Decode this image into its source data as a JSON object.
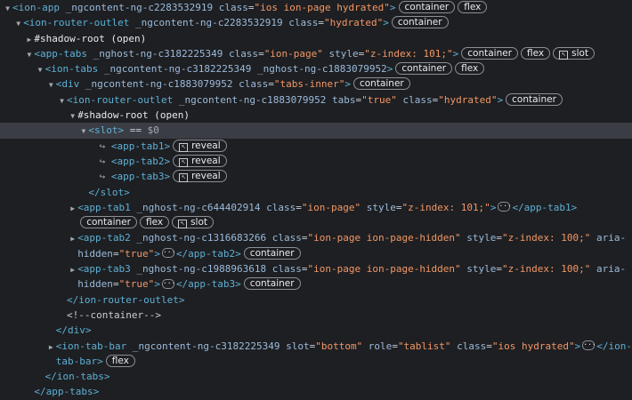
{
  "rows": [
    {
      "indent": 0,
      "tw": "▼",
      "parts": [
        {
          "c": "tag",
          "t": "<ion-app "
        },
        {
          "c": "attr",
          "t": "_ngcontent-ng-c2283532919 class"
        },
        {
          "c": "eq",
          "t": "="
        },
        {
          "c": "val",
          "t": "\"ios ion-page hydrated\""
        },
        {
          "c": "tag",
          "t": ">"
        }
      ],
      "badges": [
        {
          "t": "container"
        },
        {
          "t": "flex"
        }
      ]
    },
    {
      "indent": 1,
      "tw": "▼",
      "parts": [
        {
          "c": "tag",
          "t": "<ion-router-outlet "
        },
        {
          "c": "attr",
          "t": "_ngcontent-ng-c2283532919 class"
        },
        {
          "c": "eq",
          "t": "="
        },
        {
          "c": "val",
          "t": "\"hydrated\""
        },
        {
          "c": "tag",
          "t": ">"
        }
      ],
      "badges": [
        {
          "t": "container"
        }
      ]
    },
    {
      "indent": 2,
      "tw": "▶",
      "parts": [
        {
          "c": "plain",
          "t": "#shadow-root (open)"
        }
      ]
    },
    {
      "indent": 2,
      "tw": "▼",
      "parts": [
        {
          "c": "tag",
          "t": "<app-tabs "
        },
        {
          "c": "attr",
          "t": "_nghost-ng-c3182225349 class"
        },
        {
          "c": "eq",
          "t": "="
        },
        {
          "c": "val",
          "t": "\"ion-page\""
        },
        {
          "c": "attr",
          "t": " style"
        },
        {
          "c": "eq",
          "t": "="
        },
        {
          "c": "val",
          "t": "\"z-index: 101;\""
        },
        {
          "c": "tag",
          "t": ">"
        }
      ],
      "badges": [
        {
          "t": "container"
        },
        {
          "t": "flex"
        },
        {
          "t": "slot",
          "icon": true
        }
      ]
    },
    {
      "indent": 3,
      "tw": "▼",
      "parts": [
        {
          "c": "tag",
          "t": "<ion-tabs "
        },
        {
          "c": "attr",
          "t": "_ngcontent-ng-c3182225349 _nghost-ng-c1883079952"
        },
        {
          "c": "tag",
          "t": ">"
        }
      ],
      "badges": [
        {
          "t": "container"
        },
        {
          "t": "flex"
        }
      ]
    },
    {
      "indent": 4,
      "tw": "▼",
      "parts": [
        {
          "c": "tag",
          "t": "<div "
        },
        {
          "c": "attr",
          "t": "_ngcontent-ng-c1883079952 class"
        },
        {
          "c": "eq",
          "t": "="
        },
        {
          "c": "val",
          "t": "\"tabs-inner\""
        },
        {
          "c": "tag",
          "t": ">"
        }
      ],
      "badges": [
        {
          "t": "container"
        }
      ]
    },
    {
      "indent": 5,
      "tw": "▼",
      "parts": [
        {
          "c": "tag",
          "t": "<ion-router-outlet "
        },
        {
          "c": "attr",
          "t": "_ngcontent-ng-c1883079952 tabs"
        },
        {
          "c": "eq",
          "t": "="
        },
        {
          "c": "val",
          "t": "\"true\""
        },
        {
          "c": "attr",
          "t": " class"
        },
        {
          "c": "eq",
          "t": "="
        },
        {
          "c": "val",
          "t": "\"hydrated\""
        },
        {
          "c": "tag",
          "t": ">"
        }
      ],
      "badges": [
        {
          "t": "container"
        }
      ]
    },
    {
      "indent": 6,
      "tw": "▼",
      "parts": [
        {
          "c": "plain",
          "t": "#shadow-root (open)"
        }
      ]
    },
    {
      "indent": 7,
      "tw": "▼",
      "sel": true,
      "parts": [
        {
          "c": "tag",
          "t": "<slot>"
        },
        {
          "c": "cmt",
          "t": " == "
        },
        {
          "c": "slotref",
          "t": "$0"
        }
      ]
    },
    {
      "indent": 8,
      "tw": "",
      "parts": [
        {
          "c": "arrow",
          "t": "↪ "
        },
        {
          "c": "tag",
          "t": "<app-tab1>"
        }
      ],
      "badges": [
        {
          "t": "reveal",
          "icon": true
        }
      ]
    },
    {
      "indent": 8,
      "tw": "",
      "parts": [
        {
          "c": "arrow",
          "t": "↪ "
        },
        {
          "c": "tag",
          "t": "<app-tab2>"
        }
      ],
      "badges": [
        {
          "t": "reveal",
          "icon": true
        }
      ]
    },
    {
      "indent": 8,
      "tw": "",
      "parts": [
        {
          "c": "arrow",
          "t": "↪ "
        },
        {
          "c": "tag",
          "t": "<app-tab3>"
        }
      ],
      "badges": [
        {
          "t": "reveal",
          "icon": true
        }
      ]
    },
    {
      "indent": 7,
      "tw": "",
      "parts": [
        {
          "c": "tag",
          "t": "</slot>"
        }
      ]
    },
    {
      "indent": 6,
      "tw": "▶",
      "parts": [
        {
          "c": "tag",
          "t": "<app-tab1 "
        },
        {
          "c": "attr",
          "t": "_nghost-ng-c644402914 class"
        },
        {
          "c": "eq",
          "t": "="
        },
        {
          "c": "val",
          "t": "\"ion-page\""
        },
        {
          "c": "attr",
          "t": " style"
        },
        {
          "c": "eq",
          "t": "="
        },
        {
          "c": "val",
          "t": "\"z-index: 101;\""
        },
        {
          "c": "tag",
          "t": ">"
        },
        {
          "c": "ell",
          "t": "···"
        },
        {
          "c": "tag",
          "t": "</app-tab1>"
        }
      ]
    },
    {
      "indent": 6,
      "tw": "",
      "parts": [],
      "badges": [
        {
          "t": "container"
        },
        {
          "t": "flex"
        },
        {
          "t": "slot",
          "icon": true
        }
      ]
    },
    {
      "indent": 6,
      "tw": "▶",
      "parts": [
        {
          "c": "tag",
          "t": "<app-tab2 "
        },
        {
          "c": "attr",
          "t": "_nghost-ng-c1316683266 class"
        },
        {
          "c": "eq",
          "t": "="
        },
        {
          "c": "val",
          "t": "\"ion-page ion-page-hidden\""
        },
        {
          "c": "attr",
          "t": " style"
        },
        {
          "c": "eq",
          "t": "="
        },
        {
          "c": "val",
          "t": "\"z-index: 100;\""
        },
        {
          "c": "attr",
          "t": " aria-"
        }
      ]
    },
    {
      "indent": 6,
      "tw": "",
      "parts": [
        {
          "c": "attr",
          "t": "hidden"
        },
        {
          "c": "eq",
          "t": "="
        },
        {
          "c": "val",
          "t": "\"true\""
        },
        {
          "c": "tag",
          "t": ">"
        },
        {
          "c": "ell",
          "t": "···"
        },
        {
          "c": "tag",
          "t": "</app-tab2>"
        }
      ],
      "badges": [
        {
          "t": "container"
        }
      ]
    },
    {
      "indent": 6,
      "tw": "▶",
      "parts": [
        {
          "c": "tag",
          "t": "<app-tab3 "
        },
        {
          "c": "attr",
          "t": "_nghost-ng-c1988963618 class"
        },
        {
          "c": "eq",
          "t": "="
        },
        {
          "c": "val",
          "t": "\"ion-page ion-page-hidden\""
        },
        {
          "c": "attr",
          "t": " style"
        },
        {
          "c": "eq",
          "t": "="
        },
        {
          "c": "val",
          "t": "\"z-index: 100;\""
        },
        {
          "c": "attr",
          "t": " aria-"
        }
      ]
    },
    {
      "indent": 6,
      "tw": "",
      "parts": [
        {
          "c": "attr",
          "t": "hidden"
        },
        {
          "c": "eq",
          "t": "="
        },
        {
          "c": "val",
          "t": "\"true\""
        },
        {
          "c": "tag",
          "t": ">"
        },
        {
          "c": "ell",
          "t": "···"
        },
        {
          "c": "tag",
          "t": "</app-tab3>"
        }
      ],
      "badges": [
        {
          "t": "container"
        }
      ]
    },
    {
      "indent": 5,
      "tw": "",
      "parts": [
        {
          "c": "tag",
          "t": "</ion-router-outlet>"
        }
      ]
    },
    {
      "indent": 5,
      "tw": "",
      "parts": [
        {
          "c": "cmt",
          "t": "<!--container-->"
        }
      ]
    },
    {
      "indent": 4,
      "tw": "",
      "parts": [
        {
          "c": "tag",
          "t": "</div>"
        }
      ]
    },
    {
      "indent": 4,
      "tw": "▶",
      "parts": [
        {
          "c": "tag",
          "t": "<ion-tab-bar "
        },
        {
          "c": "attr",
          "t": "_ngcontent-ng-c3182225349 slot"
        },
        {
          "c": "eq",
          "t": "="
        },
        {
          "c": "val",
          "t": "\"bottom\""
        },
        {
          "c": "attr",
          "t": " role"
        },
        {
          "c": "eq",
          "t": "="
        },
        {
          "c": "val",
          "t": "\"tablist\""
        },
        {
          "c": "attr",
          "t": " class"
        },
        {
          "c": "eq",
          "t": "="
        },
        {
          "c": "val",
          "t": "\"ios hydrated\""
        },
        {
          "c": "tag",
          "t": ">"
        },
        {
          "c": "ell",
          "t": "···"
        },
        {
          "c": "tag",
          "t": "</ion-"
        }
      ]
    },
    {
      "indent": 4,
      "tw": "",
      "parts": [
        {
          "c": "tag",
          "t": "tab-bar>"
        }
      ],
      "badges": [
        {
          "t": "flex"
        }
      ]
    },
    {
      "indent": 3,
      "tw": "",
      "parts": [
        {
          "c": "tag",
          "t": "</ion-tabs>"
        }
      ]
    },
    {
      "indent": 2,
      "tw": "",
      "parts": [
        {
          "c": "tag",
          "t": "</app-tabs>"
        }
      ]
    }
  ]
}
